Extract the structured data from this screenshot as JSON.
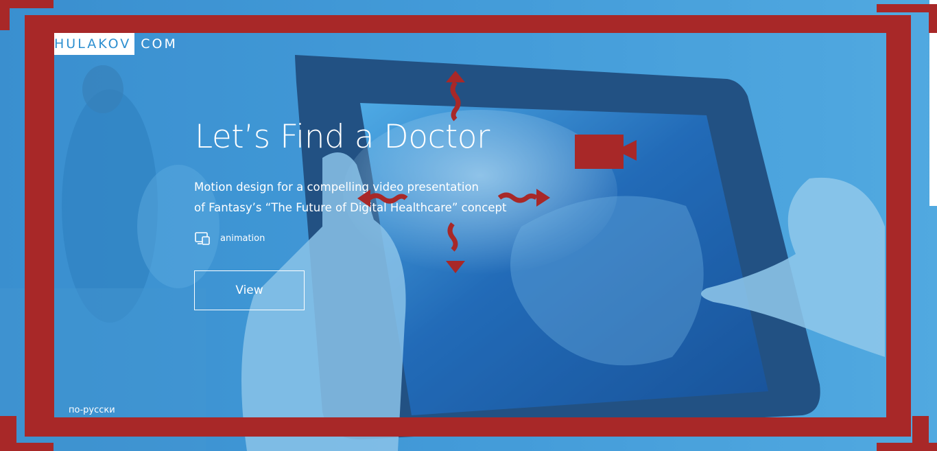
{
  "header": {
    "logo_prefix": "HULAKOV",
    "logo_suffix": "COM"
  },
  "hero": {
    "title": "Let’s Find a Doctor",
    "subtitle_line1": "Motion design for a compelling video presentation",
    "subtitle_line2": "of Fantasy’s “The Future of Digital Healthcare” concept",
    "tag_icon": "devices-icon",
    "tag_label": "animation",
    "view_label": "View"
  },
  "footer": {
    "language_link": "по-русски"
  },
  "annotations": {
    "frame_color": "#a82828",
    "camera_icon": "video-camera-icon",
    "arrows": [
      "up-arrow",
      "down-arrow",
      "left-arrow",
      "right-arrow"
    ]
  },
  "colors": {
    "overlay": "#2d8fd0",
    "text": "#ffffff"
  }
}
